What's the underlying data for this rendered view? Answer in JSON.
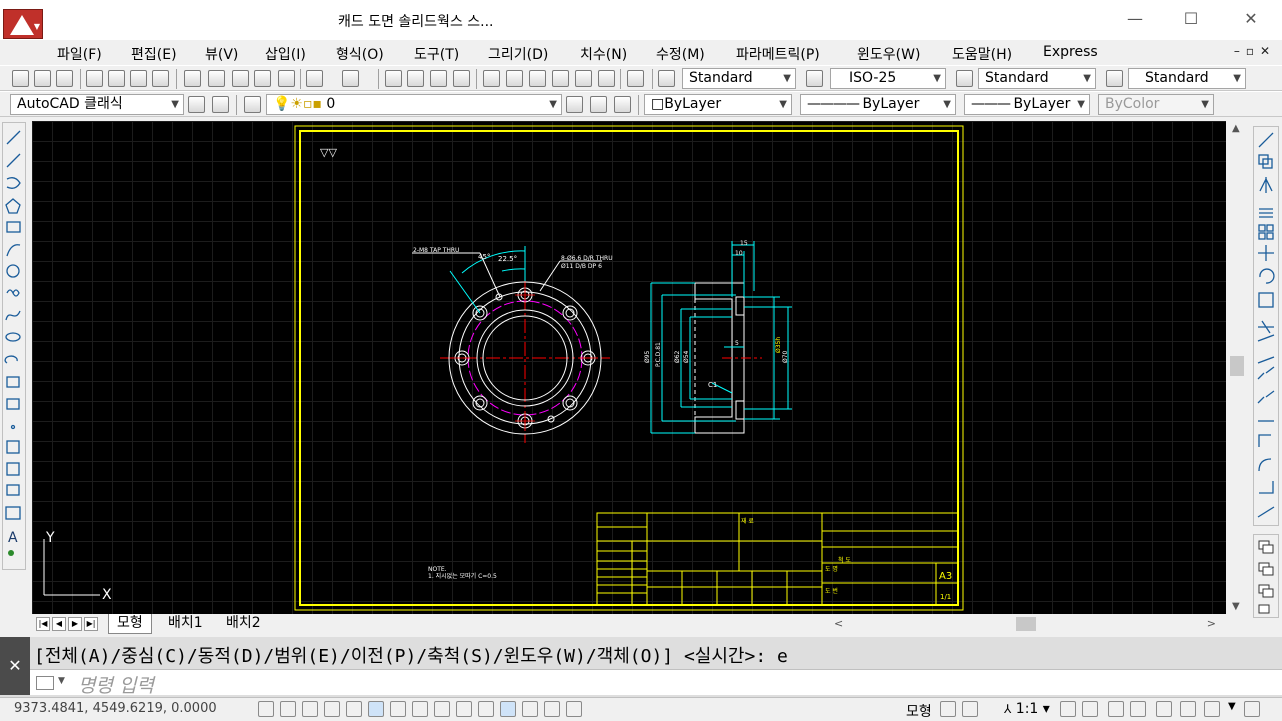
{
  "title_bar": {
    "title": "캐드 도면 솔리드웍스 스...",
    "logo": "autocad-logo-icon",
    "buttons": [
      "minimize-icon",
      "maximize-icon",
      "close-icon"
    ]
  },
  "menu": {
    "items": [
      "파일(F)",
      "편집(E)",
      "뷰(V)",
      "삽입(I)",
      "형식(O)",
      "도구(T)",
      "그리기(D)",
      "치수(N)",
      "수정(M)",
      "파라메트릭(P)",
      "윈도우(W)",
      "도움말(H)",
      "Express"
    ]
  },
  "toolbar1": {
    "text_style": "Standard",
    "dim_style": "ISO-25",
    "table_style": "Standard",
    "mleader_style": "Standard"
  },
  "toolbar2": {
    "workspace": "AutoCAD 클래식",
    "layer": "0",
    "color": "ByLayer",
    "linetype": "ByLayer",
    "lineweight": "ByLayer",
    "plotstyle": "ByColor"
  },
  "drawing": {
    "surface_mark": "▽▽",
    "tap_note": "2-M8 TAP THRU",
    "hole_note_1": "8-Ø6.6 D/R THRU",
    "hole_note_2": "Ø11 D/B DP 6",
    "angle_45": "45°",
    "angle_22": "22.5°",
    "dim_top_15": "15",
    "dim_top_10": "10",
    "dim_left_1": "Ø95",
    "dim_left_2": "P.C.D.81",
    "dim_left_3": "Ø62",
    "dim_left_4": "Ø54",
    "dim_center": "5",
    "dim_right_1": "Ø70",
    "dim_right_2": "Ø35h",
    "chamfer": "C1",
    "note_title": "NOTE.",
    "note_line": "1. 지시없는 모따기 C=0.5",
    "tb_scale_label": "척 도",
    "tb_name": "재 료",
    "tb_drawn": "도 명",
    "tb_no": "도 번",
    "tb_sheet": "A3",
    "tb_unit": "1/1"
  },
  "tabs": {
    "items": [
      "모형",
      "배치1",
      "배치2"
    ],
    "active": 0
  },
  "command": {
    "history": "[전체(A)/중심(C)/동적(D)/범위(E)/이전(P)/축척(S)/윈도우(W)/객체(O)] <실시간>: e",
    "placeholder": "명령 입력"
  },
  "status": {
    "coords": "9373.4841, 4549.6219, 0.0000",
    "model_label": "모형",
    "scale": "1:1"
  },
  "colors": {
    "canvas": "#000000",
    "frame": "#ffff00",
    "geometry": "#ffffff",
    "dimension": "#00ffff",
    "centerline": "#ff0000",
    "pcd_circle": "#ff00ff"
  }
}
